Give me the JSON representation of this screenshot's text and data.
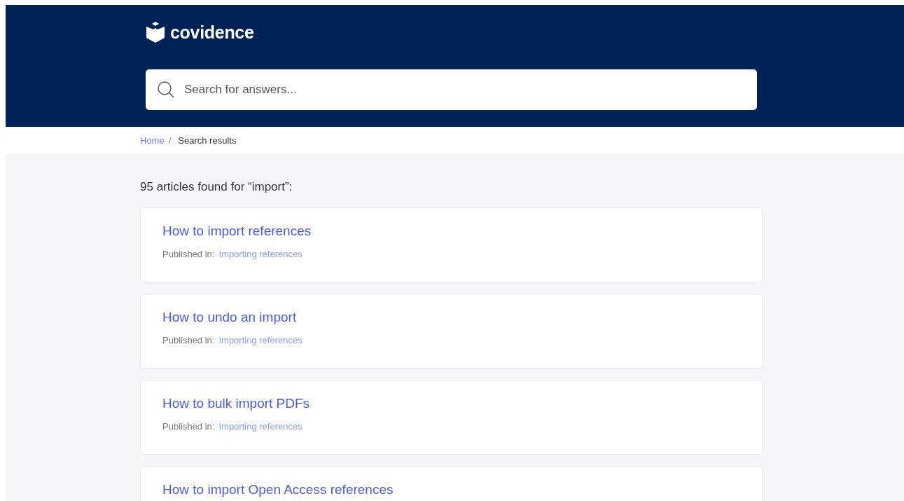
{
  "header": {
    "brand": "covidence",
    "search": {
      "placeholder": "Search for answers..."
    }
  },
  "breadcrumb": [
    {
      "label": "Home",
      "link": true,
      "separator": "/"
    },
    {
      "label": "Search results",
      "link": false
    }
  ],
  "results_heading": "95 articles found for “import”:",
  "results": [
    {
      "title": "How to import references",
      "published_label": "Published in:",
      "category": "Importing references"
    },
    {
      "title": "How to undo an import",
      "published_label": "Published in:",
      "category": "Importing references"
    },
    {
      "title": "How to bulk import PDFs",
      "published_label": "Published in:",
      "category": "Importing references"
    },
    {
      "title": "How to import Open Access references"
    }
  ]
}
